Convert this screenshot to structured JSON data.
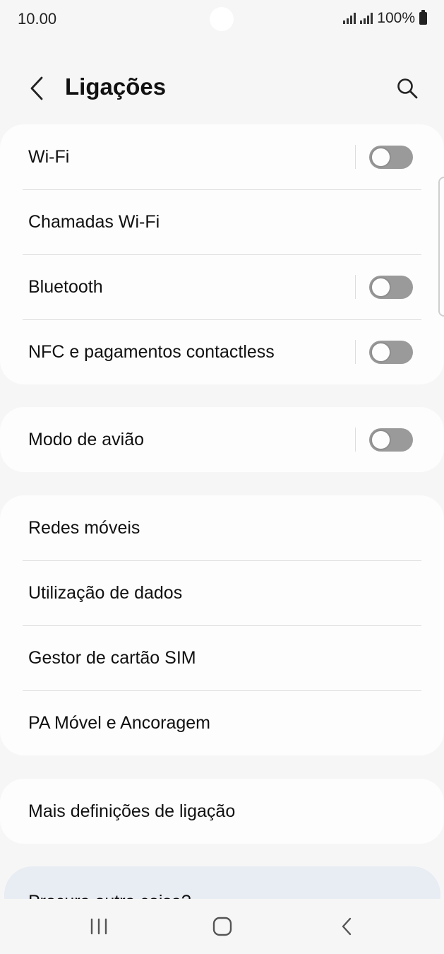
{
  "status": {
    "time": "10.00",
    "battery": "100%"
  },
  "header": {
    "title": "Ligações"
  },
  "groups": {
    "connectivity": {
      "wifi": {
        "label": "Wi-Fi",
        "on": false
      },
      "wifi_calling": {
        "label": "Chamadas Wi-Fi"
      },
      "bluetooth": {
        "label": "Bluetooth",
        "on": false
      },
      "nfc": {
        "label": "NFC e pagamentos contactless",
        "on": false
      }
    },
    "airplane": {
      "label": "Modo de avião",
      "on": false
    },
    "network": {
      "mobile_networks": "Redes móveis",
      "data_usage": "Utilização de dados",
      "sim_manager": "Gestor de cartão SIM",
      "hotspot": "PA Móvel e Ancoragem"
    },
    "more": {
      "label": "Mais definições de ligação"
    },
    "partial": {
      "label": "Procura outra coisa?"
    }
  },
  "icons": {
    "back": "chevron-left-icon",
    "search": "search-icon",
    "recents": "recents-icon",
    "home": "home-icon",
    "nav_back": "nav-back-icon"
  },
  "colors": {
    "background": "#f6f6f6",
    "card": "#fdfdfd",
    "toggle_off": "#9a9a9a",
    "partial_card": "#e8ecf3"
  }
}
